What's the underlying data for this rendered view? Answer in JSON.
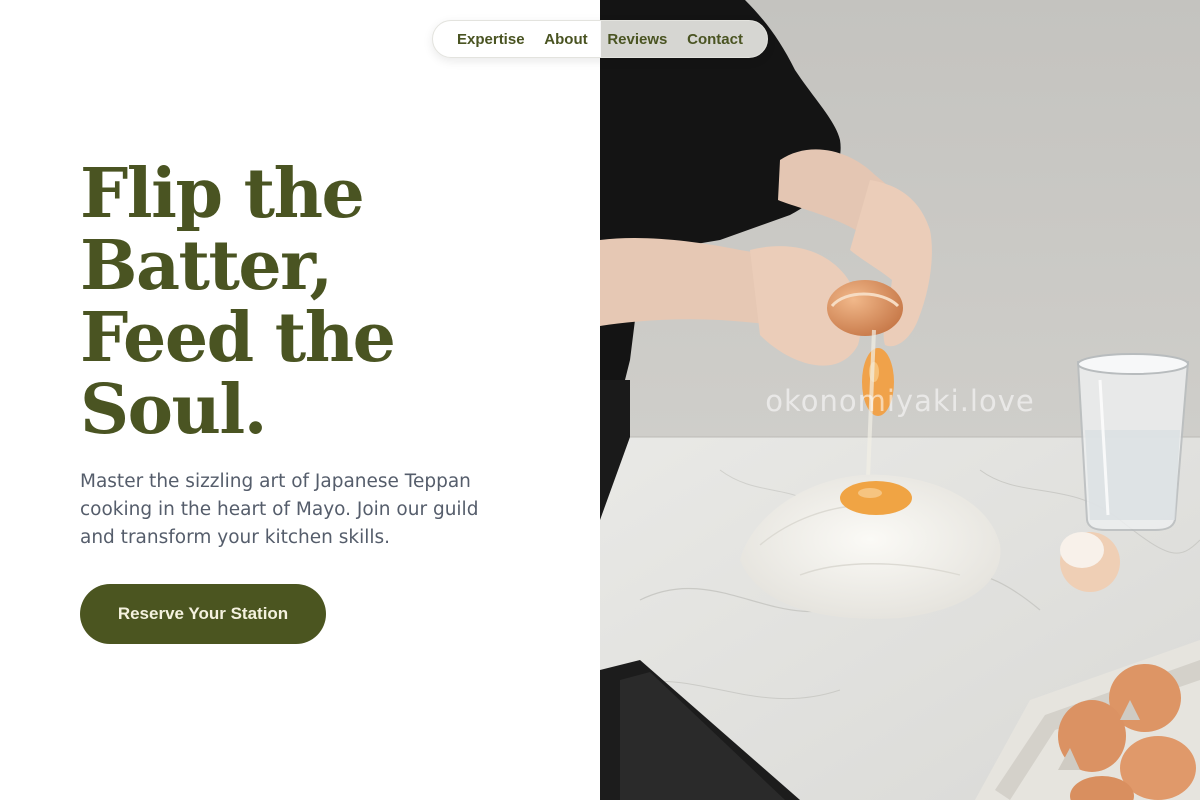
{
  "nav": {
    "items": [
      {
        "label": "Expertise"
      },
      {
        "label": "About"
      },
      {
        "label": "Reviews"
      },
      {
        "label": "Contact"
      }
    ]
  },
  "hero": {
    "headline_lines": [
      "Flip the",
      "Batter,",
      "Feed the",
      "Soul."
    ],
    "subtext": "Master the sizzling art of Japanese Teppan cooking in the heart of Mayo. Join our guild and transform your kitchen skills.",
    "cta_label": "Reserve Your Station"
  },
  "photo": {
    "subject": "hands cracking an egg into a mound of flour on a marble counter",
    "watermark": "okonomiyaki.love"
  },
  "colors": {
    "brand_olive": "#4a5422",
    "button_bg": "#4b5520",
    "button_text": "#f4f1de",
    "body_text": "#555d6b"
  }
}
